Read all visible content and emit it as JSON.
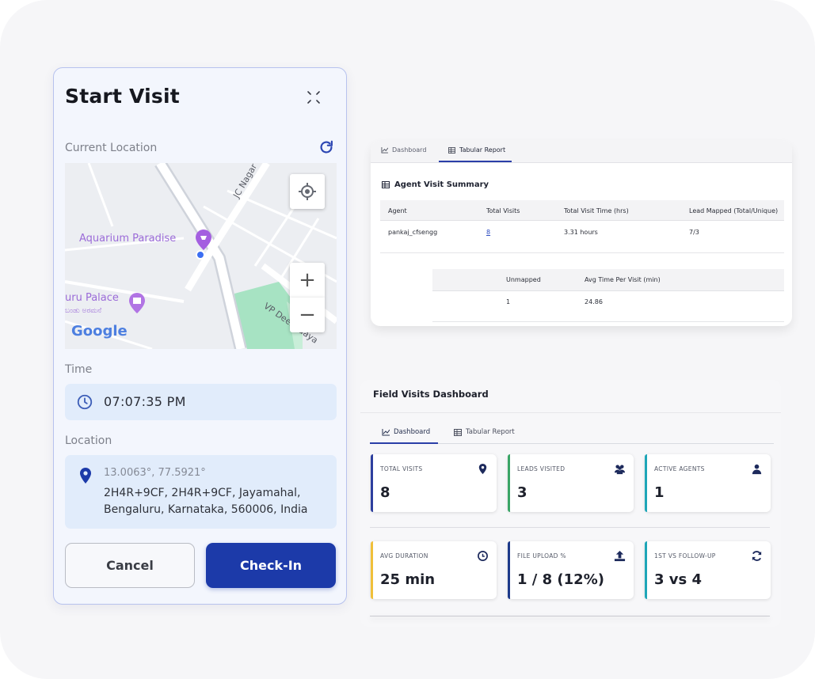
{
  "start_visit": {
    "title": "Start Visit",
    "current_location_label": "Current Location",
    "map": {
      "labels": {
        "aquarium": "Aquarium Paradise",
        "palace": "uru Palace",
        "palace_local": "ಬಂಡು ಅರಮನೆ",
        "jc_nagar": "JC Nagar M",
        "vp_road": "VP Deenadaya",
        "google": "Google"
      },
      "zoom_in": "+",
      "zoom_out": "−"
    },
    "time_label": "Time",
    "time_value": "07:07:35 PM",
    "location_label": "Location",
    "coordinates": "13.0063°, 77.5921°",
    "address": "2H4R+9CF, 2H4R+9CF, Jayamahal, Bengaluru, Karnataka, 560006, India",
    "cancel_label": "Cancel",
    "checkin_label": "Check-In",
    "accent_color": "#1c3aa9"
  },
  "report": {
    "tabs": [
      {
        "label": "Dashboard",
        "icon": "line-chart-icon"
      },
      {
        "label": "Tabular Report",
        "icon": "table-icon",
        "active": true
      }
    ],
    "summary_title": "Agent Visit Summary",
    "columns": [
      "Agent",
      "Total Visits",
      "Total Visit Time (hrs)",
      "Lead Mapped (Total/Unique)"
    ],
    "row": [
      "pankaj_cfsengg",
      "8",
      "3.31 hours",
      "7/3"
    ],
    "columns2": [
      "Unmapped",
      "Avg Time Per Visit (min)"
    ],
    "row2": [
      "1",
      "24.86"
    ]
  },
  "dashboard": {
    "title": "Field Visits Dashboard",
    "tabs": [
      {
        "label": "Dashboard",
        "icon": "line-chart-icon",
        "active": true
      },
      {
        "label": "Tabular Report",
        "icon": "table-icon"
      }
    ],
    "kpis": [
      {
        "label": "TOTAL VISITS",
        "value": "8",
        "icon": "map-pin-icon",
        "color": "#2d3f9e"
      },
      {
        "label": "LEADS VISITED",
        "value": "3",
        "icon": "users-icon",
        "color": "#3aa566"
      },
      {
        "label": "ACTIVE AGENTS",
        "value": "1",
        "icon": "user-icon",
        "color": "#1ea6b8"
      },
      {
        "label": "AVG DURATION",
        "value": "25 min",
        "icon": "clock-icon",
        "color": "#f0c03a"
      },
      {
        "label": "FILE UPLOAD %",
        "value": "1 / 8 (12%)",
        "icon": "upload-icon",
        "color": "#1d3a8a"
      },
      {
        "label": "1ST VS FOLLOW-UP",
        "value": "3 vs 4",
        "icon": "sync-icon",
        "color": "#1ea6b8"
      }
    ]
  }
}
